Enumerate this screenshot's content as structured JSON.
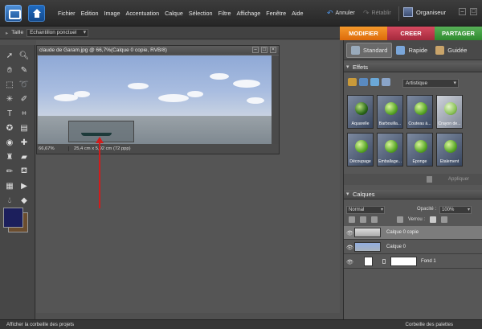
{
  "menubar": {
    "items": [
      "Fichier",
      "Edition",
      "Image",
      "Accentuation",
      "Calque",
      "Sélection",
      "Filtre",
      "Affichage",
      "Fenêtre",
      "Aide"
    ],
    "undo": "Annuler",
    "redo": "Rétablir",
    "organizer": "Organiseur"
  },
  "options": {
    "size_label": "Taille",
    "tool_select": "Echantillon ponctuel"
  },
  "tabs": [
    "MODIFIER",
    "CREER",
    "PARTAGER"
  ],
  "document": {
    "title": "claude de Garam.jpg @ 66,7%(Calque 0 copie, RVB/8)",
    "zoom": "66,67%",
    "info": "25,4 cm x 5,92 cm (72 ppp)"
  },
  "panel": {
    "modes": [
      "Standard",
      "Rapide",
      "Guidée"
    ],
    "effects_header": "Effets",
    "effects_filter": "Artistique",
    "effects": [
      "Aquarelle",
      "Barbouilla...",
      "Couteau à...",
      "Crayon de...",
      "Découpage",
      "Emballage...",
      "Eponge",
      "Etalement"
    ],
    "apply": "Appliquer",
    "layers_header": "Calques",
    "blend_mode": "Normal",
    "opacity_label": "Opacité :",
    "opacity": "100%",
    "lock_label": "Verrou :",
    "layers": [
      "Calque 0 copie",
      "Calque 0",
      "Fond 1"
    ]
  },
  "bottom": {
    "left": "Afficher la corbeille des projets",
    "right": "Corbeille des palettes"
  },
  "colors": {
    "accent_modify": "#e8801a",
    "accent_create": "#b8344a",
    "accent_share": "#3e9a3e",
    "annotation": "#d11c1c",
    "foreground": "#1c1f5c"
  }
}
